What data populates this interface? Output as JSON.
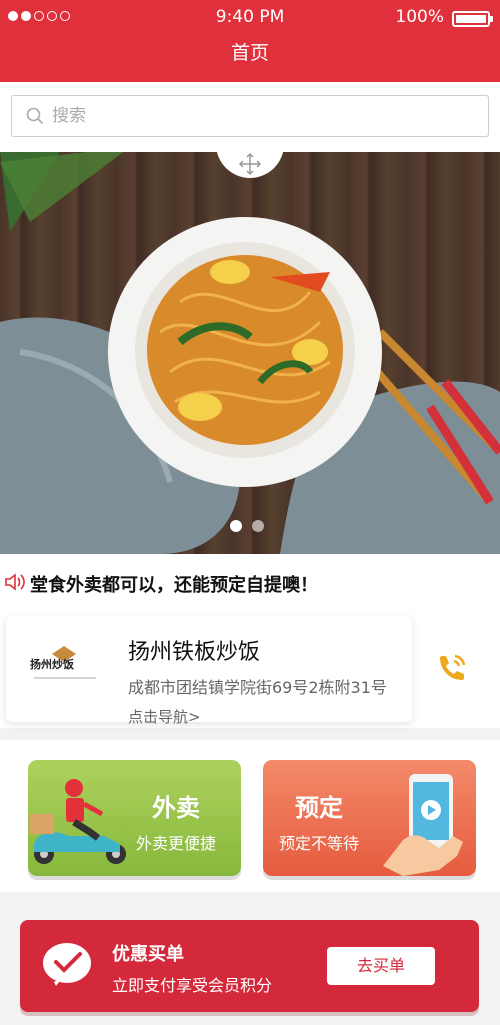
{
  "status_bar": {
    "time": "9:40 PM",
    "battery": "100%",
    "signal_dots": 5,
    "signal_filled": 2
  },
  "header": {
    "title": "首页"
  },
  "search": {
    "placeholder": "搜索"
  },
  "banner": {
    "image": "stir-fried noodles dish",
    "page_count": 2,
    "active_page": 1
  },
  "notice": {
    "text": "堂食外卖都可以，还能预定自提噢！"
  },
  "store": {
    "logo_text": "扬州炒饭",
    "name": "扬州铁板炒饭",
    "address": "成都市团结镇学院街69号2栋附31号",
    "navigate": "点击导航>"
  },
  "actions": {
    "takeout": {
      "title": "外卖",
      "subtitle": "外卖更便捷"
    },
    "reserve": {
      "title": "预定",
      "subtitle": "预定不等待"
    }
  },
  "promo": {
    "title": "优惠买单",
    "subtitle": "立即支付享受会员积分",
    "button": "去买单"
  },
  "colors": {
    "primary_red": "#e0303c",
    "takeout_green": "#9bc54b",
    "reserve_orange": "#ee7254",
    "phone_yellow": "#f0a81c"
  }
}
